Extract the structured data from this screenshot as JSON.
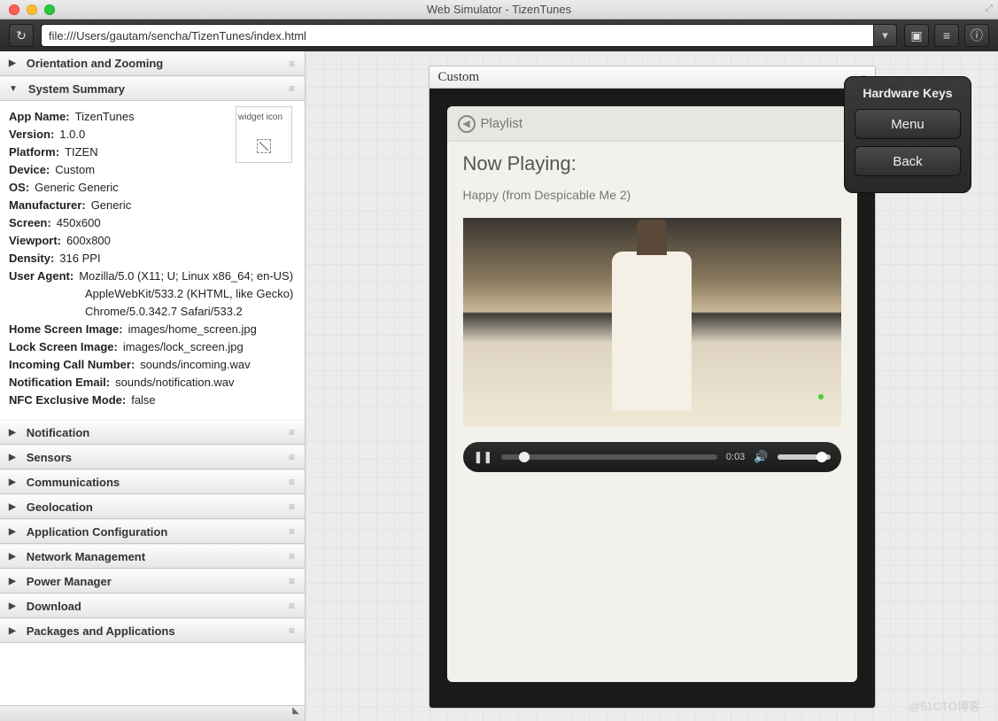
{
  "window": {
    "title": "Web Simulator - TizenTunes"
  },
  "toolbar": {
    "url": "file:///Users/gautam/sencha/TizenTunes/index.html"
  },
  "sidebar": {
    "sections": [
      {
        "label": "Orientation and Zooming",
        "expanded": false
      },
      {
        "label": "System Summary",
        "expanded": true
      },
      {
        "label": "Notification",
        "expanded": false
      },
      {
        "label": "Sensors",
        "expanded": false
      },
      {
        "label": "Communications",
        "expanded": false
      },
      {
        "label": "Geolocation",
        "expanded": false
      },
      {
        "label": "Application Configuration",
        "expanded": false
      },
      {
        "label": "Network Management",
        "expanded": false
      },
      {
        "label": "Power Manager",
        "expanded": false
      },
      {
        "label": "Download",
        "expanded": false
      },
      {
        "label": "Packages and Applications",
        "expanded": false
      }
    ],
    "summary": {
      "widget_icon_label": "widget icon",
      "rows": [
        {
          "label": "App Name:",
          "value": "TizenTunes"
        },
        {
          "label": "Version:",
          "value": "1.0.0"
        },
        {
          "label": "Platform:",
          "value": "TIZEN"
        },
        {
          "label": "Device:",
          "value": "Custom"
        },
        {
          "label": "OS:",
          "value": "Generic Generic"
        },
        {
          "label": "Manufacturer:",
          "value": "Generic"
        },
        {
          "label": "Screen:",
          "value": "450x600"
        },
        {
          "label": "Viewport:",
          "value": "600x800"
        },
        {
          "label": "Density:",
          "value": "316 PPI"
        },
        {
          "label": "User Agent:",
          "value": "Mozilla/5.0 (X11; U; Linux x86_64; en-US)"
        }
      ],
      "ua_extra": [
        "AppleWebKit/533.2 (KHTML, like Gecko)",
        "Chrome/5.0.342.7 Safari/533.2"
      ],
      "rows2": [
        {
          "label": "Home Screen Image:",
          "value": "images/home_screen.jpg"
        },
        {
          "label": "Lock Screen Image:",
          "value": "images/lock_screen.jpg"
        },
        {
          "label": "Incoming Call Number:",
          "value": "sounds/incoming.wav"
        },
        {
          "label": "Notification Email:",
          "value": "sounds/notification.wav"
        },
        {
          "label": "NFC Exclusive Mode:",
          "value": "false"
        }
      ]
    }
  },
  "device": {
    "header": "Custom",
    "app": {
      "back_label": "Playlist",
      "heading": "Now Playing:",
      "track": "Happy (from Despicable Me 2)",
      "time": "0:03"
    }
  },
  "hardware": {
    "title": "Hardware Keys",
    "menu": "Menu",
    "back": "Back"
  },
  "watermark": "@51CTO博客"
}
